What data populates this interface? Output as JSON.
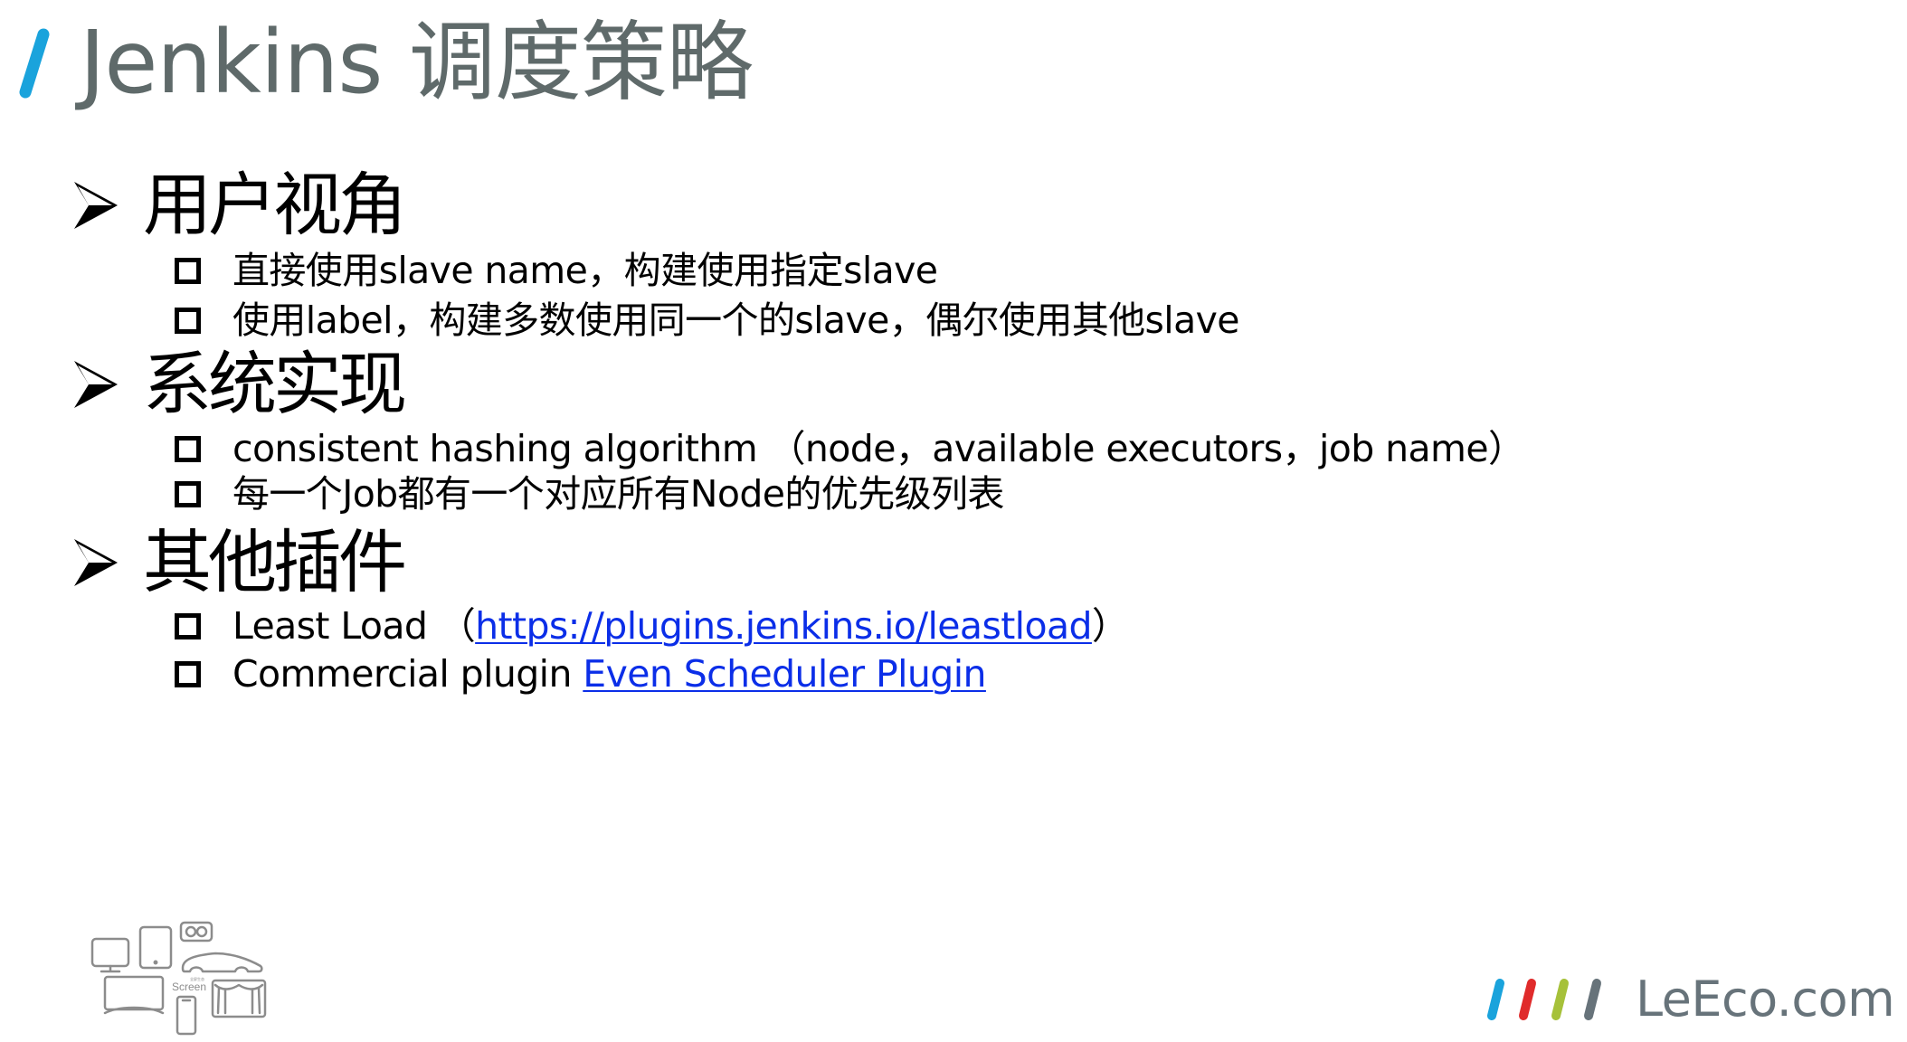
{
  "slide": {
    "title": "Jenkins 调度策略",
    "accent_color": "#1aa3dc",
    "title_color": "#5f6a6a",
    "link_color": "#0b2ee8"
  },
  "sections": [
    {
      "heading": "用户视角",
      "bullets": [
        {
          "text": "直接使用slave name，构建使用指定slave"
        },
        {
          "text": "使用label，构建多数使用同一个的slave，偶尔使用其他slave"
        }
      ]
    },
    {
      "heading": "系统实现",
      "bullets": [
        {
          "text": "consistent hashing algorithm （node，available executors，job name）"
        },
        {
          "text": "每一个Job都有一个对应所有Node的优先级列表"
        }
      ]
    },
    {
      "heading": "其他插件",
      "bullets": [
        {
          "prefix": "Least Load （",
          "link": "https://plugins.jenkins.io/leastload",
          "suffix": "）"
        },
        {
          "prefix": "Commercial plugin ",
          "link": "Even Scheduler Plugin",
          "suffix": ""
        }
      ]
    }
  ],
  "footer": {
    "device_icons": {
      "icons": [
        "monitor-icon",
        "tablet-icon",
        "vr-goggles-icon",
        "car-icon",
        "tv-icon",
        "phone-icon",
        "theater-icon"
      ],
      "caption_small": "全屏生态",
      "caption": "Screen"
    },
    "brand": {
      "name": "LeEco.com",
      "slash_colors": [
        "#1aa3dc",
        "#e02b2b",
        "#a6c13a",
        "#67737a"
      ]
    }
  }
}
